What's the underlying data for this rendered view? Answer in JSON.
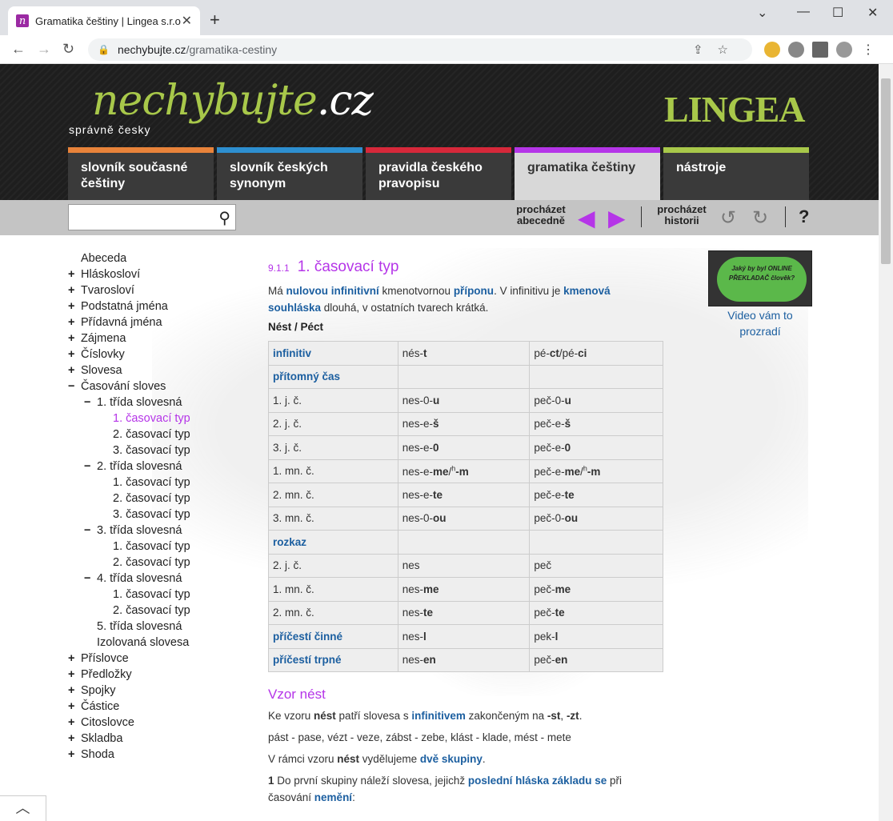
{
  "browser": {
    "tab_title": "Gramatika češtiny | Lingea s.r.o.",
    "favicon_letter": "n",
    "url_host": "nechybujte.cz",
    "url_path": "/gramatika-cestiny"
  },
  "header": {
    "logo_main": "nechybujte",
    "logo_suffix": ".cz",
    "tagline": "správně česky",
    "brand": "LINGEA"
  },
  "nav": {
    "tabs": [
      {
        "label": "slovník současné češtiny",
        "color": "#e8833a"
      },
      {
        "label": "slovník českých synonym",
        "color": "#2d8fd0"
      },
      {
        "label": "pravidla českého pravopisu",
        "color": "#d6283a"
      },
      {
        "label": "gramatika češtiny",
        "color": "#b535e8"
      },
      {
        "label": "nástroje",
        "color": "#a8c84a"
      }
    ]
  },
  "toolbar": {
    "browse_alpha": "procházet abecedně",
    "browse_history": "procházet historii",
    "help": "?"
  },
  "sidebar": {
    "items": [
      {
        "pm": "",
        "label": "Abeceda",
        "indent": 0
      },
      {
        "pm": "+",
        "label": "Hláskosloví",
        "indent": 0
      },
      {
        "pm": "+",
        "label": "Tvarosloví",
        "indent": 0
      },
      {
        "pm": "+",
        "label": "Podstatná jména",
        "indent": 0
      },
      {
        "pm": "+",
        "label": "Přídavná jména",
        "indent": 0
      },
      {
        "pm": "+",
        "label": "Zájmena",
        "indent": 0
      },
      {
        "pm": "+",
        "label": "Číslovky",
        "indent": 0
      },
      {
        "pm": "+",
        "label": "Slovesa",
        "indent": 0
      },
      {
        "pm": "−",
        "label": "Časování sloves",
        "indent": 0
      },
      {
        "pm": "−",
        "label": "1. třída slovesná",
        "indent": 1
      },
      {
        "pm": "",
        "label": "1. časovací typ",
        "indent": 2,
        "active": true
      },
      {
        "pm": "",
        "label": "2. časovací typ",
        "indent": 2
      },
      {
        "pm": "",
        "label": "3. časovací typ",
        "indent": 2
      },
      {
        "pm": "−",
        "label": "2. třída slovesná",
        "indent": 1
      },
      {
        "pm": "",
        "label": "1. časovací typ",
        "indent": 2
      },
      {
        "pm": "",
        "label": "2. časovací typ",
        "indent": 2
      },
      {
        "pm": "",
        "label": "3. časovací typ",
        "indent": 2
      },
      {
        "pm": "−",
        "label": "3. třída slovesná",
        "indent": 1
      },
      {
        "pm": "",
        "label": "1. časovací typ",
        "indent": 2
      },
      {
        "pm": "",
        "label": "2. časovací typ",
        "indent": 2
      },
      {
        "pm": "−",
        "label": "4. třída slovesná",
        "indent": 1
      },
      {
        "pm": "",
        "label": "1. časovací typ",
        "indent": 2
      },
      {
        "pm": "",
        "label": "2. časovací typ",
        "indent": 2
      },
      {
        "pm": "",
        "label": "5. třída slovesná",
        "indent": 1
      },
      {
        "pm": "",
        "label": "Izolovaná slovesa",
        "indent": 1
      },
      {
        "pm": "+",
        "label": "Příslovce",
        "indent": 0
      },
      {
        "pm": "+",
        "label": "Předložky",
        "indent": 0
      },
      {
        "pm": "+",
        "label": "Spojky",
        "indent": 0
      },
      {
        "pm": "+",
        "label": "Částice",
        "indent": 0
      },
      {
        "pm": "+",
        "label": "Citoslovce",
        "indent": 0
      },
      {
        "pm": "+",
        "label": "Skladba",
        "indent": 0
      },
      {
        "pm": "+",
        "label": "Shoda",
        "indent": 0
      }
    ]
  },
  "article": {
    "section_num": "9.1.1",
    "title": "1. časovací typ",
    "intro": [
      "Má ",
      "nulovou infinitivní",
      " kmenotvornou ",
      "příponu",
      ". V infinitivu je ",
      "kmenová souhláska",
      " dlouhá, v ostatních tvarech krátká."
    ],
    "verbs": "Nést / Péct",
    "table": [
      [
        "infinitiv",
        "nés-t",
        "pé-ct/pé-ci",
        true
      ],
      [
        "přítomný čas",
        "",
        "",
        true
      ],
      [
        "1. j. č.",
        "nes-0-u",
        "peč-0-u",
        false
      ],
      [
        "2. j. č.",
        "nes-e-š",
        "peč-e-š",
        false
      ],
      [
        "3. j. č.",
        "nes-e-0",
        "peč-e-0",
        false
      ],
      [
        "1. mn. č.",
        "nes-e-me/h-m",
        "peč-e-me/h-m",
        false
      ],
      [
        "2. mn. č.",
        "nes-e-te",
        "peč-e-te",
        false
      ],
      [
        "3. mn. č.",
        "nes-0-ou",
        "peč-0-ou",
        false
      ],
      [
        "rozkaz",
        "",
        "",
        true
      ],
      [
        "2. j. č.",
        "nes",
        "peč",
        false
      ],
      [
        "1. mn. č.",
        "nes-me",
        "peč-me",
        false
      ],
      [
        "2. mn. č.",
        "nes-te",
        "peč-te",
        false
      ],
      [
        "příčestí činné",
        "nes-l",
        "pek-l",
        true
      ],
      [
        "příčestí trpné",
        "nes-en",
        "peč-en",
        true
      ]
    ],
    "vzor_title": "Vzor nést",
    "vzor_p1": [
      "Ke vzoru ",
      "nést",
      " patří slovesa s ",
      "infinitivem",
      " zakončeným na ",
      "-st",
      ", ",
      "-zt",
      "."
    ],
    "vzor_p2": "pást - pase, vézt - veze, zábst - zebe, klást - klade, mést - mete",
    "vzor_p3": [
      "V rámci vzoru ",
      "nést",
      " vydělujeme ",
      "dvě skupiny",
      "."
    ],
    "vzor_p4": [
      "1",
      "  Do první skupiny náleží slovesa, jejichž ",
      "poslední hláska základu se",
      " při časování ",
      "nemění",
      ":"
    ]
  },
  "ad": {
    "bubble": "Jaký by byl ONLINE PŘEKLADAČ člověk?",
    "caption": "Video vám to prozradí"
  }
}
